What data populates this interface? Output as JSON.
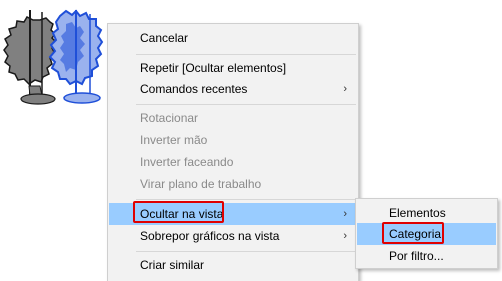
{
  "context_menu": {
    "items": [
      {
        "label": "Cancelar",
        "enabled": true
      },
      {
        "label": "Repetir [Ocultar elementos]",
        "enabled": true
      },
      {
        "label": "Comandos recentes",
        "enabled": true,
        "submenu": true
      },
      {
        "label": "Rotacionar",
        "enabled": false
      },
      {
        "label": "Inverter mão",
        "enabled": false
      },
      {
        "label": "Inverter faceando",
        "enabled": false
      },
      {
        "label": "Virar plano de trabalho",
        "enabled": false
      },
      {
        "label": "Ocultar na vista",
        "enabled": true,
        "submenu": true,
        "highlighted": true
      },
      {
        "label": "Sobrepor gráficos na vista",
        "enabled": true,
        "submenu": true
      },
      {
        "label": "Criar similar",
        "enabled": true
      }
    ],
    "arrow_glyph": "›"
  },
  "submenu": {
    "items": [
      {
        "label": "Elementos"
      },
      {
        "label": "Categoria",
        "highlighted": true
      },
      {
        "label": "Por filtro..."
      }
    ]
  },
  "colors": {
    "highlight": "#99ccff",
    "annotation_red": "#e00000",
    "menu_background": "#f2f2f2",
    "tree_gray": "#808080",
    "tree_selected_blue": "#1f4fd8"
  }
}
